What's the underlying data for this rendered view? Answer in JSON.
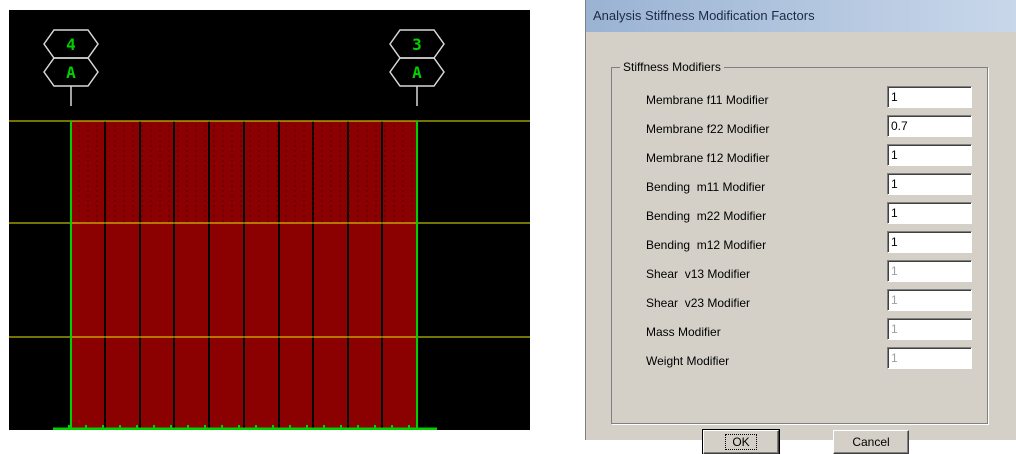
{
  "model_view": {
    "bubbles": [
      {
        "number": "4",
        "letter": "A"
      },
      {
        "number": "3",
        "letter": "A"
      }
    ],
    "colors": {
      "background": "#000000",
      "wall_fill": "#8b0000",
      "grid_line": "#e8e800",
      "frame_line": "#00d000",
      "bubble_text": "#00d000",
      "bubble_outline": "#d8d8d8"
    }
  },
  "dialog": {
    "title": "Analysis Stiffness Modification Factors",
    "group_title": "Stiffness Modifiers",
    "rows": [
      {
        "label": "Membrane f11 Modifier",
        "value": "1",
        "enabled": true
      },
      {
        "label": "Membrane f22 Modifier",
        "value": "0.7",
        "enabled": true
      },
      {
        "label": "Membrane f12 Modifier",
        "value": "1",
        "enabled": true
      },
      {
        "label": "Bending  m11 Modifier",
        "value": "1",
        "enabled": true
      },
      {
        "label": "Bending  m22 Modifier",
        "value": "1",
        "enabled": true
      },
      {
        "label": "Bending  m12 Modifier",
        "value": "1",
        "enabled": true
      },
      {
        "label": "Shear  v13 Modifier",
        "value": "1",
        "enabled": false
      },
      {
        "label": "Shear  v23 Modifier",
        "value": "1",
        "enabled": false
      },
      {
        "label": "Mass Modifier",
        "value": "1",
        "enabled": false
      },
      {
        "label": "Weight Modifier",
        "value": "1",
        "enabled": false
      }
    ],
    "ok_label": "OK",
    "cancel_label": "Cancel"
  }
}
